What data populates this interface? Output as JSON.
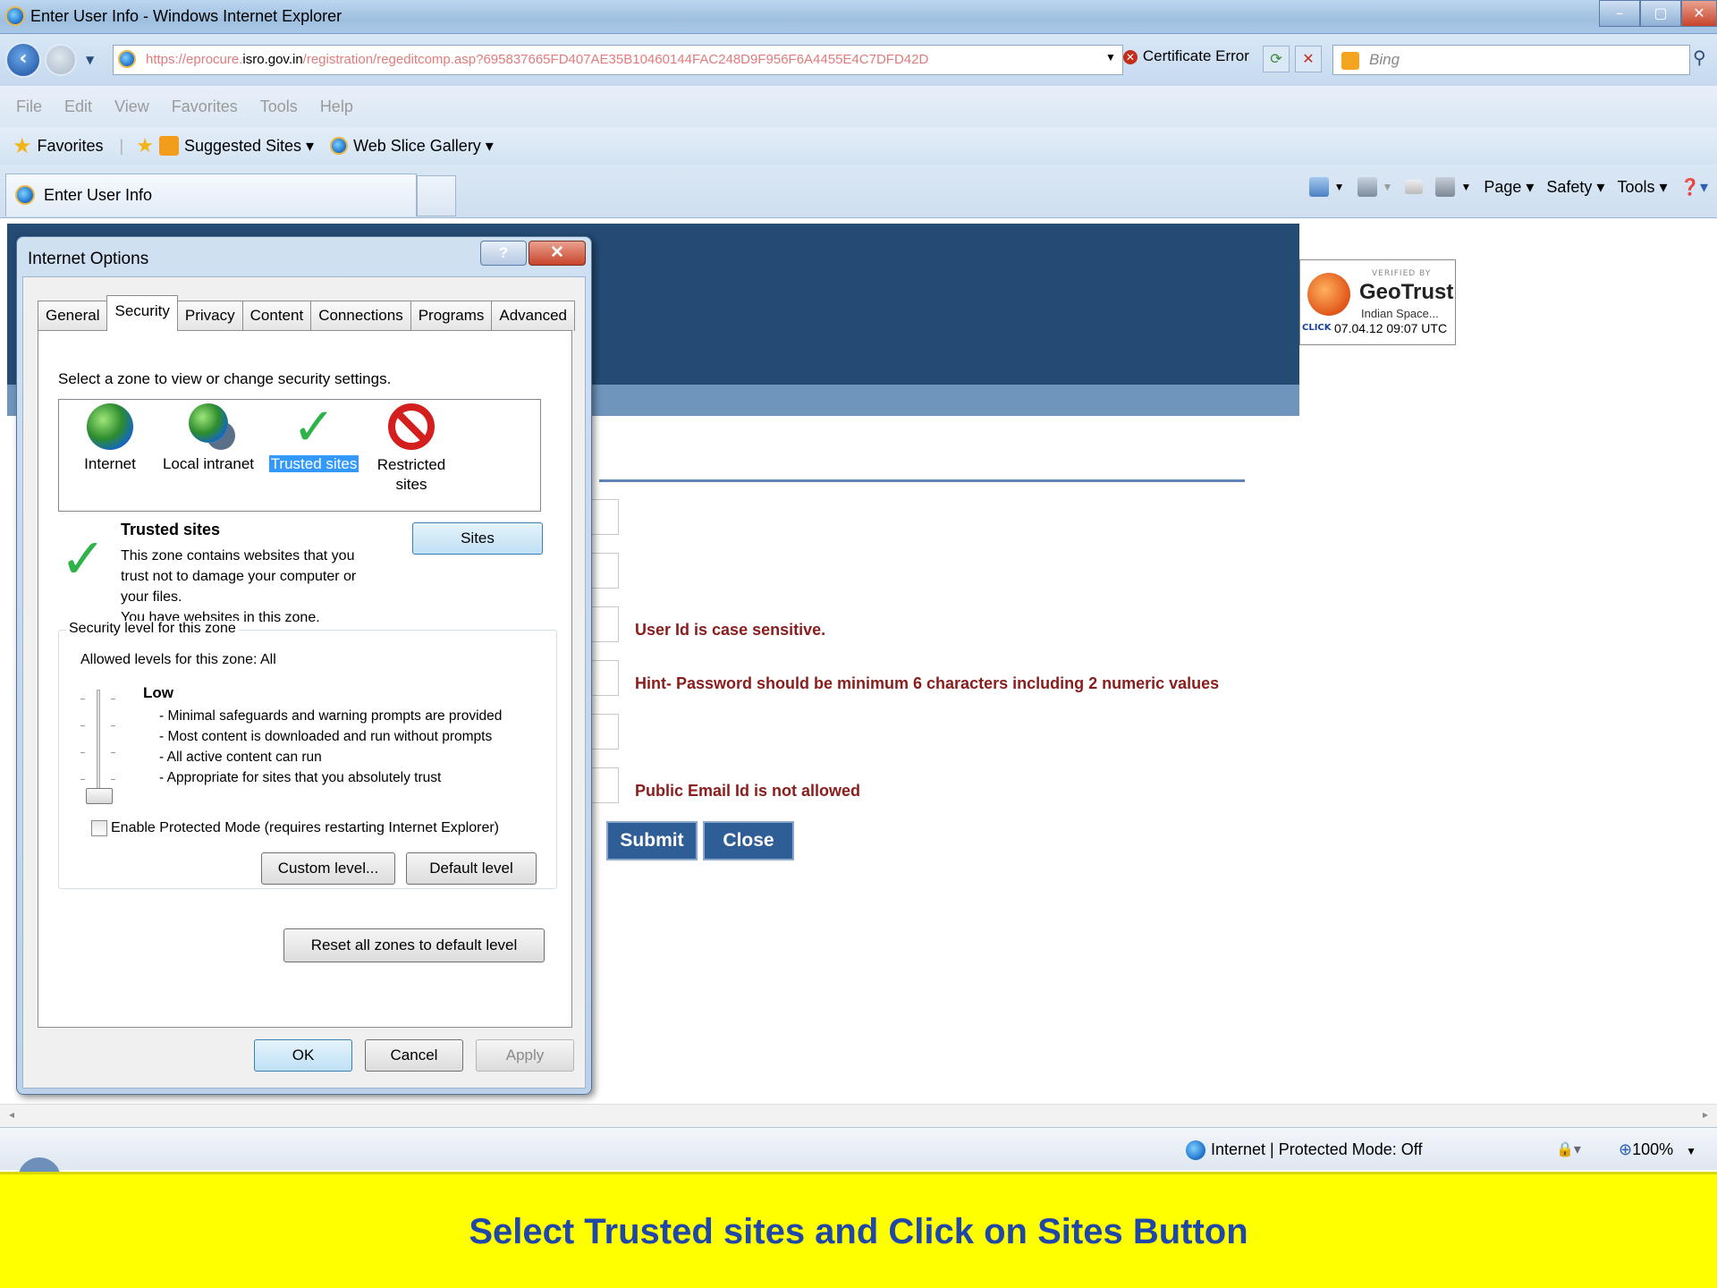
{
  "window": {
    "title": "Enter User Info - Windows Internet Explorer",
    "controls": [
      "–",
      "▢",
      "✕"
    ]
  },
  "address": {
    "url_prefix": "https://eprocure.",
    "url_domain": "isro.gov.in",
    "url_path": "/registration/regeditcomp.asp?695837665FD407AE35B10460144FAC248D9F956F6A4455E4C7DFD42D",
    "cert_error": "Certificate Error",
    "search_placeholder": "Bing"
  },
  "menu": [
    "File",
    "Edit",
    "View",
    "Favorites",
    "Tools",
    "Help"
  ],
  "favorites": {
    "label": "Favorites",
    "suggested": "Suggested Sites ▾",
    "webslice": "Web Slice Gallery ▾"
  },
  "tab": {
    "title": "Enter User Info"
  },
  "commands": {
    "page": "Page ▾",
    "safety": "Safety ▾",
    "tools": "Tools ▾",
    "help": "❓▾"
  },
  "geotrust": {
    "verified": "VERIFIED BY",
    "brand": "GeoTrust",
    "org": "Indian Space...",
    "click": "CLICK",
    "date": "07.04.12 09:07 UTC"
  },
  "page": {
    "msg_userid": "User Id is case sensitive.",
    "msg_password": "Hint-  Password should be minimum 6 characters including 2 numeric values",
    "msg_email": "Public Email Id is not allowed",
    "submit": "Submit",
    "close": "Close"
  },
  "status": {
    "text": "Internet | Protected Mode: Off",
    "zoom": "100%"
  },
  "dialog": {
    "title": "Internet Options",
    "help": "?",
    "close": "✕",
    "tabs": [
      "General",
      "Security",
      "Privacy",
      "Content",
      "Connections",
      "Programs",
      "Advanced"
    ],
    "select_zone": "Select a zone to view or change security settings.",
    "zones": [
      "Internet",
      "Local intranet",
      "Trusted sites",
      "Restricted sites"
    ],
    "zone_title": "Trusted sites",
    "zone_desc_1": "This zone contains websites that you",
    "zone_desc_2": "trust not to damage your computer or",
    "zone_desc_3": "your files.",
    "zone_desc_4": "You have websites in this zone.",
    "sites_button": "Sites",
    "security_level": "Security level for this zone",
    "allowed_levels": "Allowed levels for this zone: All",
    "level_name": "Low",
    "level_points": [
      "- Minimal safeguards and warning prompts are provided",
      "- Most content is downloaded and run without prompts",
      "- All active content can run",
      "- Appropriate for sites that you absolutely trust"
    ],
    "protected_mode": "Enable Protected Mode (requires restarting Internet Explorer)",
    "custom_level": "Custom level...",
    "default_level": "Default level",
    "reset_all": "Reset all zones to default level",
    "ok": "OK",
    "cancel": "Cancel",
    "apply": "Apply"
  },
  "caption": "Select Trusted sites and Click on Sites Button"
}
